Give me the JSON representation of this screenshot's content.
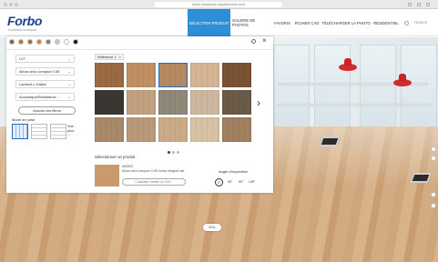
{
  "browser": {
    "url": "farbo-business.nepaservice.com"
  },
  "site": {
    "logo": "Forbo",
    "logo_sub": "FLOORING SYSTEMS",
    "nav": [
      "SÉLECTION PRODUIT",
      "GALERIE DE PHOTOS",
      "FAVORIS",
      "FICHIER CAD",
      "TÉLÉCHARGER LA PHOTO",
      "RÉSIDENTIEL"
    ],
    "lang": "FRANCE"
  },
  "panel": {
    "color_filters": [
      "#8b5a2b",
      "#b5733a",
      "#9c6b3f",
      "#e07a1f",
      "#7d7d7d",
      "#c8c8c8",
      "#ffffff",
      "#111111"
    ],
    "filters": [
      {
        "label": "LVT"
      },
      {
        "label": "Allura click compact 0,55"
      },
      {
        "label": "Lames/Lo Dalles"
      },
      {
        "label": "Acoustique/Résistance..."
      }
    ],
    "cancel_filters": "Annuler les filtres",
    "mode_title": "Mode de pose",
    "mode_more": [
      "Voir",
      "plus",
      "..."
    ],
    "tab_label": "Référence 1",
    "tiles": [
      "#9a6a45",
      "#c08f62",
      "#b58963",
      "#d4b596",
      "#7a5334",
      "#3a3733",
      "#c1a180",
      "#8f8777",
      "#cdb89f",
      "#6b5a47",
      "#a88a6a",
      "#b89a7a",
      "#c9ab88",
      "#d6c2a5",
      "#a08060"
    ],
    "selected_title": "Sélectionner un produit",
    "selected_name": [
      "w60052",
      "Allura click compact 0,55 honey elegant oak"
    ],
    "selected_btn": "Consulter l'article ou Voir...",
    "angle_title": "Angle d'exposition",
    "angles": [
      "0°",
      "45°",
      "90°",
      "135°"
    ]
  },
  "scene": {
    "floor_label": "SOL"
  }
}
